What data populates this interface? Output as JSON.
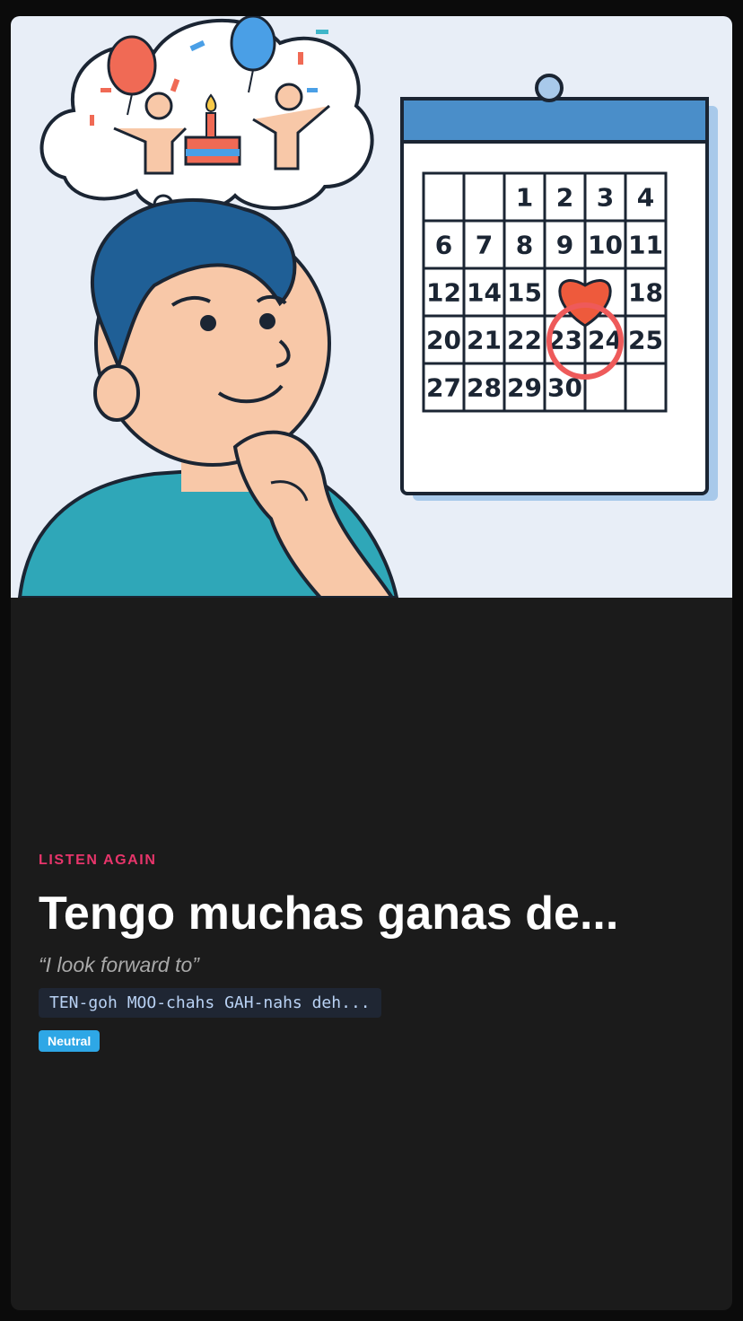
{
  "lesson": {
    "eyebrow": "LISTEN AGAIN",
    "phrase": "Tengo muchas ganas de...",
    "translation": "“I look forward to”",
    "pronunciation": "TEN-goh MOO-chahs GAH-nahs deh...",
    "tone_badge": "Neutral"
  },
  "illustration": {
    "calendar_days": [
      [
        "",
        "",
        "1",
        "2",
        "3",
        "4"
      ],
      [
        "6",
        "7",
        "8",
        "9",
        "10",
        "11"
      ],
      [
        "12",
        "14",
        "15",
        "",
        "",
        "18"
      ],
      [
        "20",
        "21",
        "22",
        "23",
        "24",
        "25"
      ],
      [
        "27",
        "28",
        "29",
        "30",
        "",
        ""
      ]
    ]
  },
  "colors": {
    "eyebrow": "#e8356b",
    "badge": "#2ea7e6",
    "card_background": "#1b1b1b"
  }
}
